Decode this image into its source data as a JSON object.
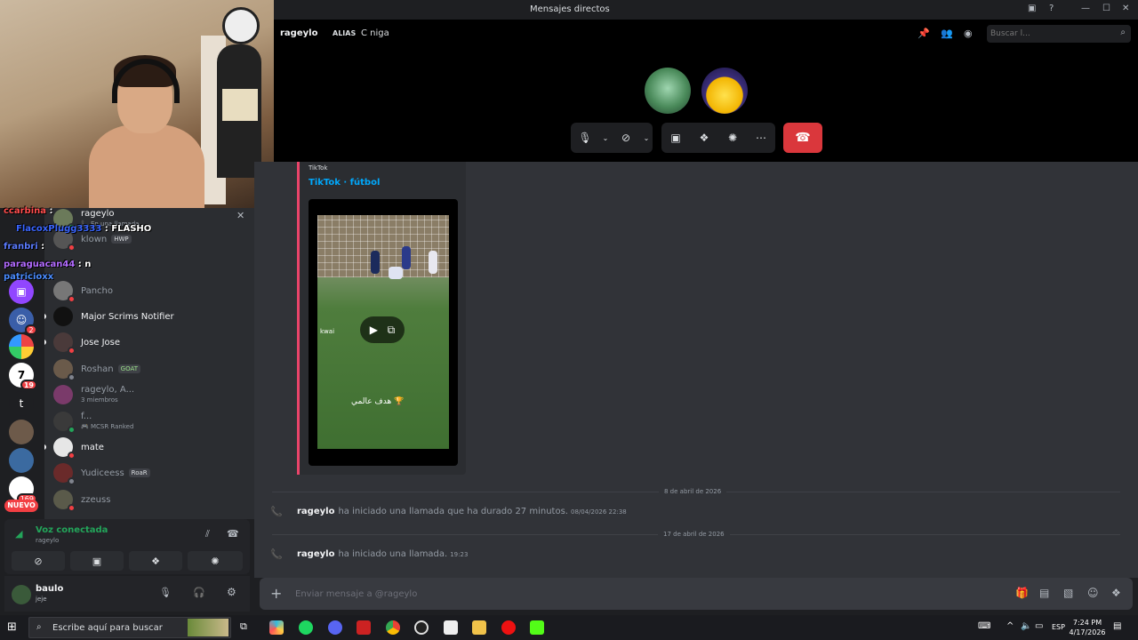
{
  "window": {
    "title": "Mensajes directos"
  },
  "header": {
    "dm_name": "rageylo",
    "alias_label": "ALIAS",
    "alias_value": "C niga",
    "search_placeholder": "Buscar l..."
  },
  "dm_list": {
    "items": [
      {
        "name": "rageylo",
        "status_text": "En una llamada",
        "bright": true
      },
      {
        "name": "klown",
        "tag": "HWP"
      },
      {
        "name": "Pancho"
      },
      {
        "name": "Major Scrims Notifier",
        "bright": true
      },
      {
        "name": "Jose Jose",
        "bright": true
      },
      {
        "name": "Roshan",
        "tag": "GOAT"
      },
      {
        "name": "rageylo, A...",
        "status_text": "3 miembros"
      },
      {
        "name": "f...",
        "status_text": "MCSR Ranked"
      },
      {
        "name": "mate",
        "bright": true
      },
      {
        "name": "Yudiceess",
        "tag": "RoaR"
      },
      {
        "name": "zzeuss"
      }
    ]
  },
  "chat_overlay": [
    {
      "user": "ccarbina",
      "message": "",
      "color": "#ff4d4d"
    },
    {
      "user": "FlacoxPlugg3333",
      "message": "FLASHO",
      "color": "#3a66ff"
    },
    {
      "user": "franbri",
      "message": "",
      "color": "#5b7cff"
    },
    {
      "user": "paraguacan44",
      "message": "n",
      "color": "#b26bff"
    },
    {
      "user": "patricioxx",
      "message": "",
      "color": "#4a8cff"
    }
  ],
  "server_rail": {
    "badges": [
      "2",
      "19",
      "169"
    ],
    "new_label": "NUEVO",
    "letter_server": "t"
  },
  "voice_panel": {
    "status": "Voz conectada",
    "channel": "rageylo"
  },
  "user_panel": {
    "name": "baulo",
    "status": "jeje"
  },
  "embed": {
    "provider": "TikTok",
    "title": "TikTok · fútbol",
    "watermark": "kwai",
    "caption": "هدف عالمي 🏆"
  },
  "messages": {
    "dividers": [
      "8 de abril de 2026",
      "17 de abril de 2026"
    ],
    "calls": [
      {
        "user": "rageylo",
        "text": "ha iniciado una llamada que ha durado 27 minutos.",
        "time": "08/04/2026 22:38"
      },
      {
        "user": "rageylo",
        "text": "ha iniciado una llamada.",
        "time": "19:23"
      }
    ]
  },
  "composer": {
    "placeholder": "Enviar mensaje a @rageylo"
  },
  "taskbar": {
    "search_text": "Escribe aquí para buscar",
    "lang": "ESP",
    "time": "7:24 PM",
    "date": "4/17/2026"
  },
  "colors": {
    "accent": "#5865f2",
    "danger": "#da373c",
    "online": "#23a55a",
    "link": "#00a8fc",
    "embed_border": "#e9446a"
  }
}
